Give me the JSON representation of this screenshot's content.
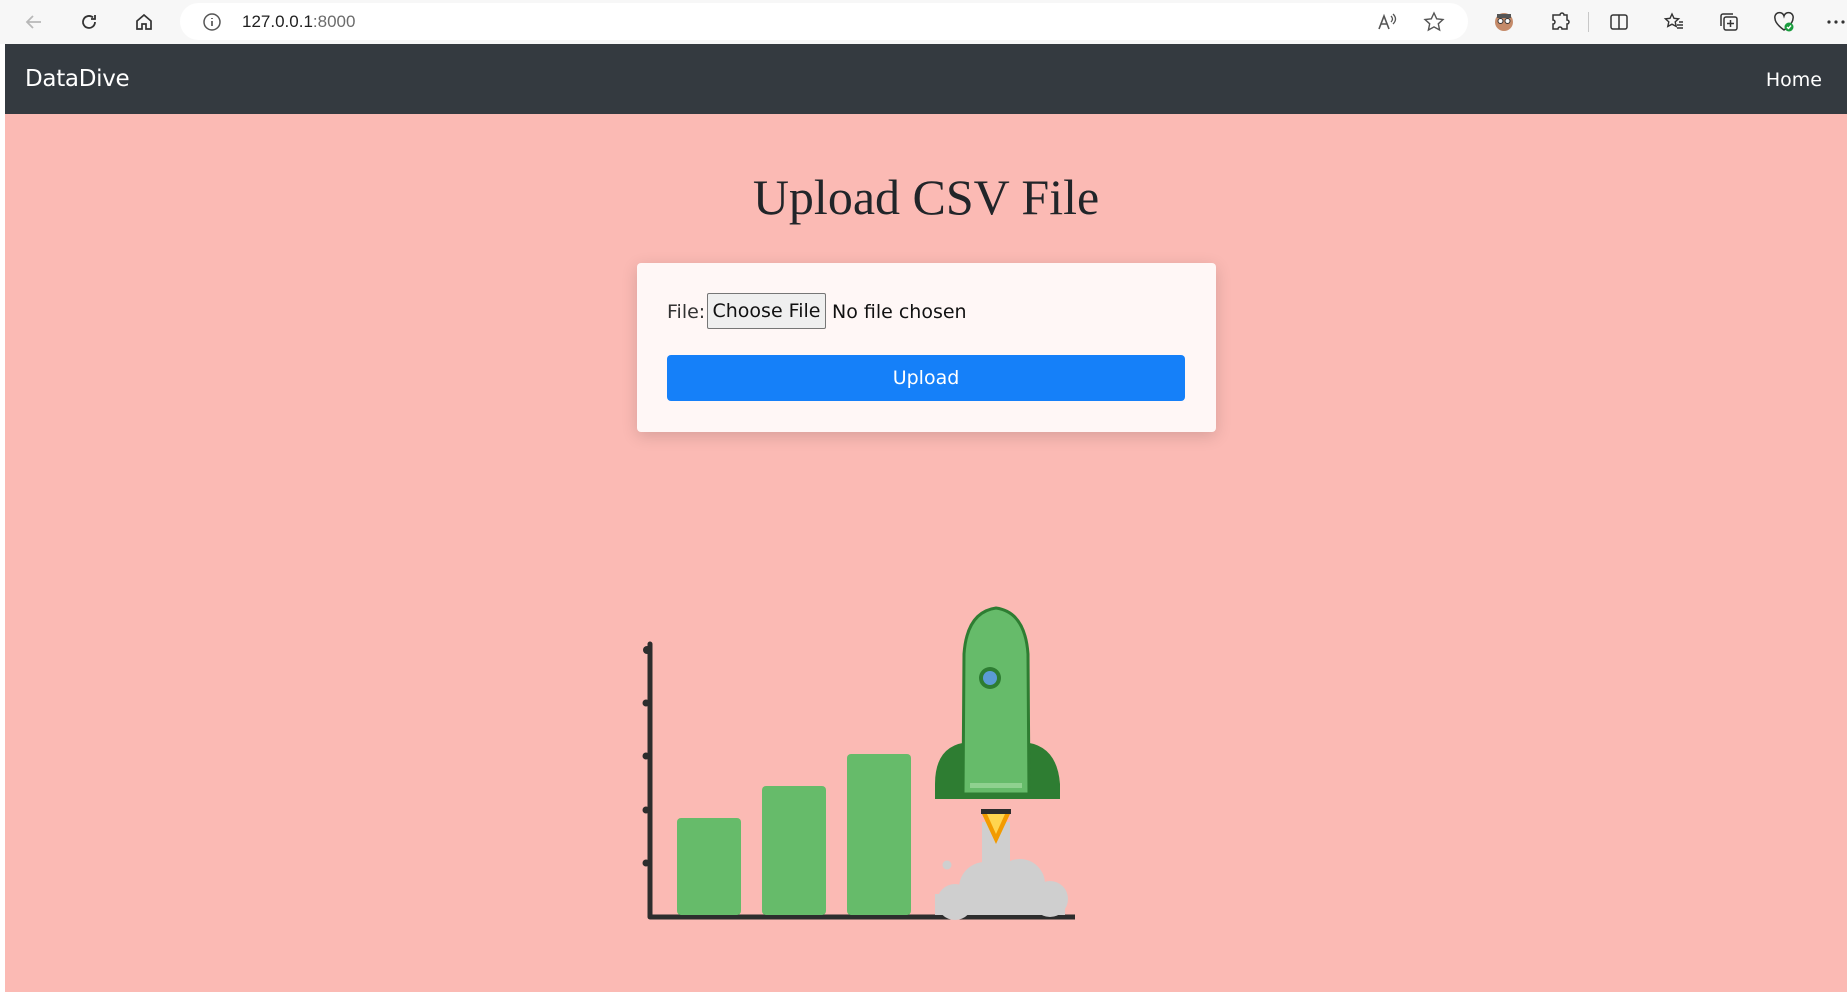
{
  "browser": {
    "url_host": "127.0.0.1",
    "url_port": ":8000"
  },
  "navbar": {
    "brand": "DataDive",
    "links": [
      {
        "label": "Home"
      }
    ]
  },
  "main": {
    "title": "Upload CSV File",
    "form": {
      "file_label": "File:",
      "choose_button": "Choose File",
      "file_status": "No file chosen",
      "submit_button": "Upload"
    }
  },
  "colors": {
    "page_background": "#fbbab4",
    "navbar_background": "#343a40",
    "primary_button": "#1580f9",
    "bar_green": "#66bb6a",
    "rocket_dark_green": "#2e7d32"
  },
  "illustration": {
    "bars": [
      {
        "name": "bar-1",
        "relative_height": 0.46
      },
      {
        "name": "bar-2",
        "relative_height": 0.61
      },
      {
        "name": "bar-3",
        "relative_height": 0.76
      }
    ]
  }
}
